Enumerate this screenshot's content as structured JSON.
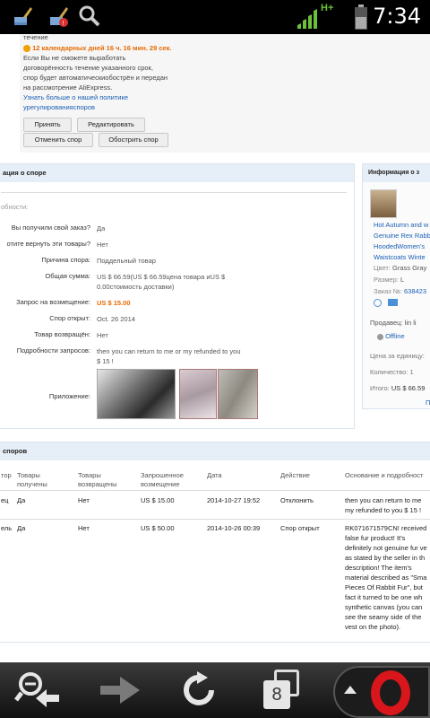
{
  "status_bar": {
    "time": "7:34",
    "network": "H+",
    "icons": [
      "broom-icon",
      "broom-alert-icon",
      "search-icon",
      "signal-icon",
      "battery-icon"
    ]
  },
  "top_panel": {
    "line_top": "течение",
    "timer": "12 календарных дней 16 ч. 16 мин. 29 сек.",
    "text1": "Если Вы не сможете выработать",
    "text2": "договорённость течение указанного срок,",
    "text3": "спор будет автоматическиобострён и передан",
    "text4": "на рассмотрение AliExpress.",
    "link1": "Узнать больше о нашей политике",
    "link2": "урегулированияспоров",
    "accept": "Принять",
    "edit": "Редактировать",
    "cancel": "Отменить спор",
    "escalate": "Обострить спор"
  },
  "dispute_info": {
    "heading": "ация о  споре",
    "details": "обности:",
    "rows": [
      {
        "label": "Вы получили свой заказ?",
        "value": "Да"
      },
      {
        "label": "отите вернуть эти товары?",
        "value": "Нет"
      },
      {
        "label": "Причина спора:",
        "value": "Поддельный товар"
      },
      {
        "label": "Общая сумма:",
        "value": "US $ 66.59(US $ 66.59цена товара иUS $",
        "value2": "0.00стоимость доставки)"
      },
      {
        "label": "Запрос на возмещение:",
        "value": "US $ 15.00"
      },
      {
        "label": "Спор открыт:",
        "value": "Oct. 26 2014"
      },
      {
        "label": "Товар возвращён:",
        "value": "Нет"
      },
      {
        "label": "Подробности запросов:",
        "value": "then you can return to  me or my refunded to you",
        "value2": "$ 15 !"
      },
      {
        "label": "Приложение:",
        "value": ""
      }
    ]
  },
  "order_info": {
    "heading": "Информация о з",
    "product_link": [
      "Hot Autumn and w",
      "Genuine Rex Rabb",
      "HoodedWomen's",
      "Waistcoats Winte"
    ],
    "color_label": "Цвет:",
    "color_value": "Grass Gray",
    "size_label": "Размер:",
    "size_value": "L",
    "order_label": "Заказ №:",
    "order_value": "638423",
    "seller_label": "Продавец:",
    "seller_value": "lin li",
    "status": "Offline",
    "unit_price_label": "Цена за единицу:",
    "qty_label": "Количество:",
    "qty_value": "1",
    "total_label": "Итого:",
    "total_value": "US $ 66.59",
    "more": "П"
  },
  "history": {
    "heading": "споров",
    "columns": [
      "тор",
      "Товары получены",
      "Товары возвращены",
      "Запрошенное возмещение",
      "Дата",
      "Действие",
      "Основание и подробност"
    ],
    "rows": [
      {
        "actor": "ец",
        "received": "Да",
        "returned": "Нет",
        "refund": "US $ 15.00",
        "date": "2014-10-27 19:52",
        "action": "Отклонить",
        "reason": [
          "then you can return to me",
          "my refunded to you $ 15 !"
        ]
      },
      {
        "actor": "ель",
        "received": "Да",
        "returned": "Нет",
        "refund": "US $ 50.00",
        "date": "2014-10-26 00:39",
        "action": "Спор открыт",
        "reason": [
          "RK071671579CN! received",
          "false fur product! It's",
          "definitely not genuine fur ve",
          "as stated by the seller in th",
          "description! The item's",
          "material described as \"Sma",
          "Pieces Of Rabbit Fur\", but",
          "fact it turned to be one wh",
          "synthetic canvas (you can",
          "see the seamy side of the",
          "vest on the photo)."
        ]
      }
    ]
  },
  "nav_bar": {
    "tabs_count": "8",
    "icons": [
      "zoom-out-back-icon",
      "forward-arrow-icon",
      "reload-icon",
      "tabs-icon",
      "opera-menu-icon"
    ]
  }
}
